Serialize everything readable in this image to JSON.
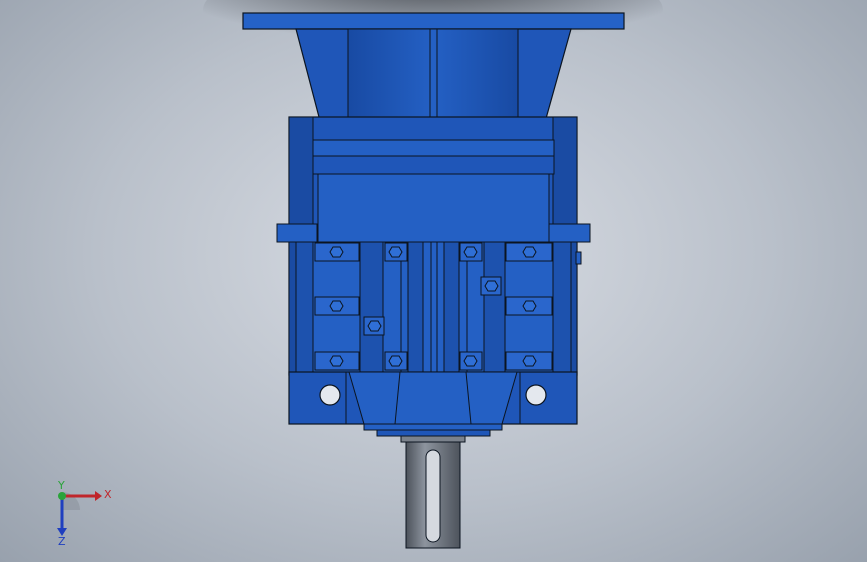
{
  "viewport": {
    "background_center": "#d9dde4",
    "background_edge": "#98a1ad"
  },
  "model": {
    "body_color": "#1f56b8",
    "body_dark": "#133f8f",
    "body_light": "#2f6fd6",
    "shaft_color": "#6d7480",
    "outline_color": "#0b1420"
  },
  "triad": {
    "x_label": "X",
    "y_label": "Y",
    "z_label": "Z",
    "x_color": "#c0262b",
    "y_color": "#2aa33a",
    "z_color": "#1f3fbf"
  }
}
